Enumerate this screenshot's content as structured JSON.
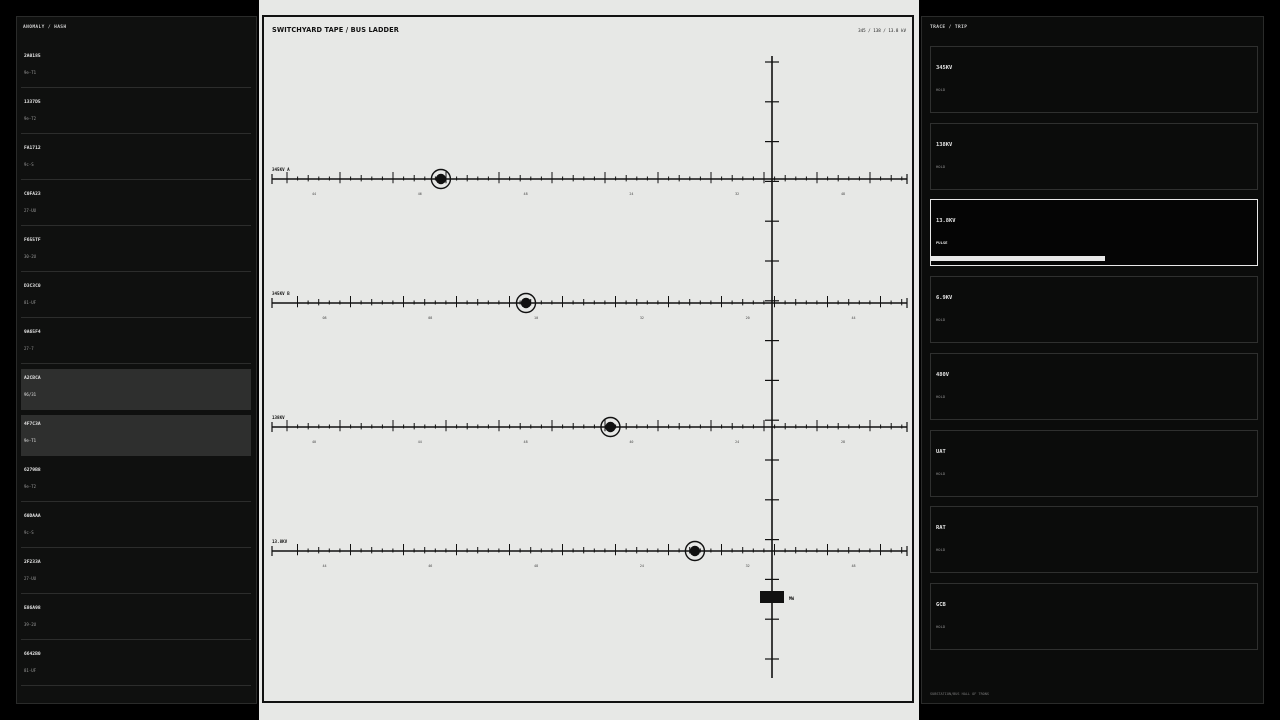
{
  "left_panel": {
    "heading": "ANOMALY / HASH",
    "items": [
      {
        "code": "2A0185",
        "tag": "9e-T1",
        "selected": false
      },
      {
        "code": "1337D5",
        "tag": "9e-T2",
        "selected": false
      },
      {
        "code": "FA1712",
        "tag": "9c-S",
        "selected": false
      },
      {
        "code": "C0FA23",
        "tag": "27-UU",
        "selected": false
      },
      {
        "code": "F655TF",
        "tag": "30-2U",
        "selected": false
      },
      {
        "code": "D3C3C0",
        "tag": "81-UF",
        "selected": false
      },
      {
        "code": "9A65F4",
        "tag": "27-7",
        "selected": false
      },
      {
        "code": "A2CBCA",
        "tag": "96/31",
        "selected": true
      },
      {
        "code": "4F7C3A",
        "tag": "9e-T1",
        "selected": true
      },
      {
        "code": "6279B8",
        "tag": "9e-T2",
        "selected": false
      },
      {
        "code": "60DAAA",
        "tag": "9c-S",
        "selected": false
      },
      {
        "code": "2F233A",
        "tag": "27-UU",
        "selected": false
      },
      {
        "code": "E86A98",
        "tag": "39-2U",
        "selected": false
      },
      {
        "code": "6642B0",
        "tag": "81-UF",
        "selected": false
      }
    ]
  },
  "center": {
    "title": "SWITCHYARD TAPE  /  BUS LADDER",
    "readout": "345 / 138 / 13.8 kV",
    "unit_label": "MW",
    "buses": [
      {
        "label": "345KV A",
        "marker": 0.266,
        "ticks": [
          "44",
          "46",
          "48",
          "24",
          "32",
          "48"
        ]
      },
      {
        "label": "345KV B",
        "marker": 0.4,
        "ticks": [
          "08",
          "08",
          "10",
          "32",
          "20",
          "44"
        ]
      },
      {
        "label": "138KV",
        "marker": 0.533,
        "ticks": [
          "40",
          "44",
          "48",
          "40",
          "24",
          "28"
        ]
      },
      {
        "label": "13.8KV",
        "marker": 0.666,
        "ticks": [
          "44",
          "46",
          "48",
          "24",
          "32",
          "48"
        ]
      }
    ]
  },
  "right_panel": {
    "heading": "TRACE / TRIP",
    "items": [
      {
        "bus": "345KV",
        "status": "HOLD",
        "active": false
      },
      {
        "bus": "138KV",
        "status": "HOLD",
        "active": false
      },
      {
        "bus": "13.8KV",
        "status": "PULSE",
        "active": true,
        "progress": 0.53
      },
      {
        "bus": "6.9KV",
        "status": "HOLD",
        "active": false
      },
      {
        "bus": "480V",
        "status": "HOLD",
        "active": false
      },
      {
        "bus": "UAT",
        "status": "HOLD",
        "active": false
      },
      {
        "bus": "RAT",
        "status": "HOLD",
        "active": false
      },
      {
        "bus": "GCB",
        "status": "HOLD",
        "active": false
      }
    ],
    "footer": "SUBSTATION/BUS HALL OF TRONS"
  },
  "colors": {
    "accent": "#e8e8e8",
    "ink": "#111111",
    "paper": "#e7e8e6"
  }
}
